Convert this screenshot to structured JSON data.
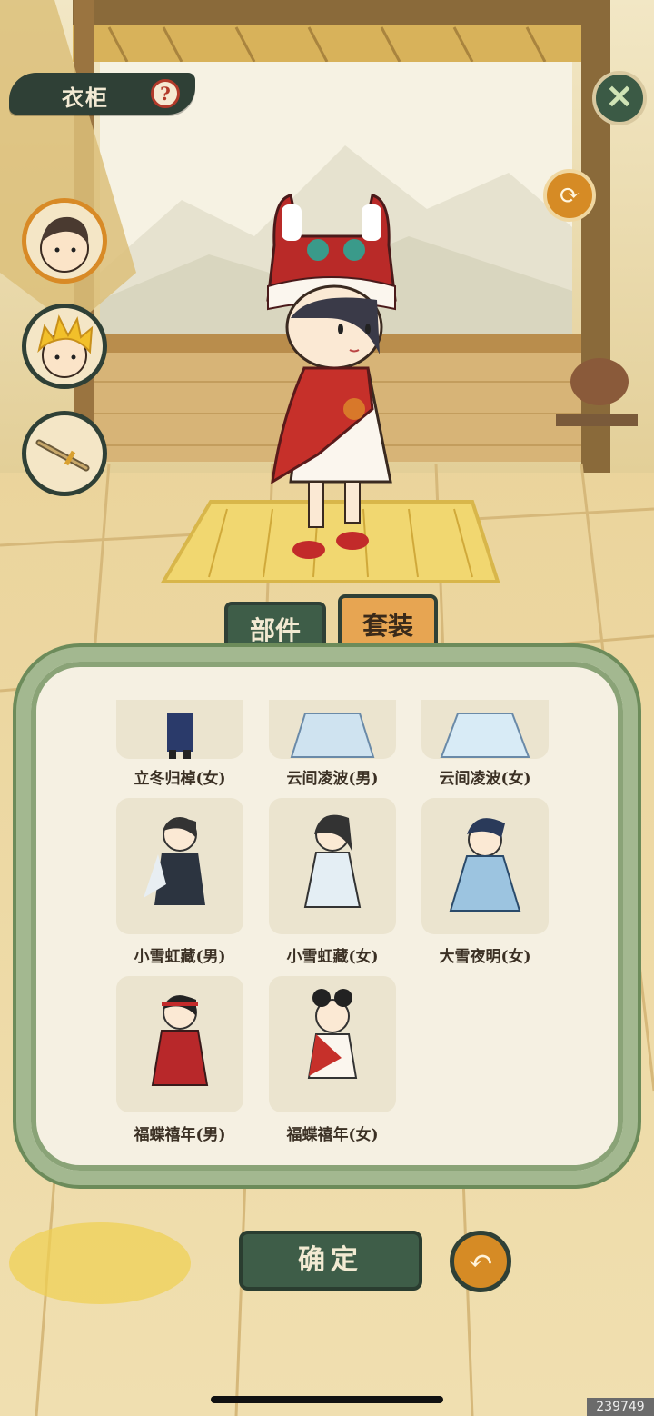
{
  "header": {
    "title": "衣柜",
    "help_glyph": "?"
  },
  "top_buttons": {
    "close_glyph": "✕",
    "refresh_glyph": "⟳"
  },
  "portraits": [
    {
      "name": "male-portrait",
      "selected": true
    },
    {
      "name": "blonde-portrait",
      "selected": false
    },
    {
      "name": "sword-item",
      "selected": false
    }
  ],
  "tabs": [
    {
      "label": "部件",
      "active": true
    },
    {
      "label": "套装",
      "active": false
    }
  ],
  "outfits": [
    {
      "label": "立冬归棹(女)",
      "row": 0
    },
    {
      "label": "云间凌波(男)",
      "row": 0
    },
    {
      "label": "云间凌波(女)",
      "row": 0
    },
    {
      "label": "小雪虹藏(男)",
      "row": 1
    },
    {
      "label": "小雪虹藏(女)",
      "row": 1
    },
    {
      "label": "大雪夜明(女)",
      "row": 1
    },
    {
      "label": "福蝶禧年(男)",
      "row": 2
    },
    {
      "label": "福蝶禧年(女)",
      "row": 2
    }
  ],
  "footer": {
    "confirm_label": "确定",
    "back_glyph": "↶"
  },
  "watermark": "239749",
  "colors": {
    "dark_green": "#2f4036",
    "button_green": "#3e5d48",
    "orange": "#d68b25",
    "panel_border": "#a3b890"
  }
}
